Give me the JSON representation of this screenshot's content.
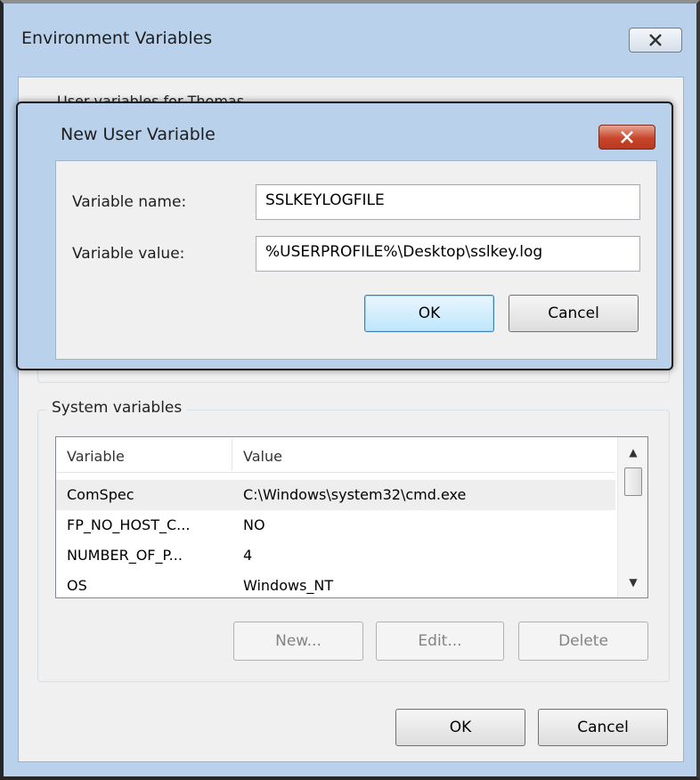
{
  "env_window": {
    "title": "Environment Variables",
    "user_group_legend": "User variables for Thomas",
    "system_group": {
      "legend": "System variables",
      "columns": [
        "Variable",
        "Value"
      ],
      "rows": [
        {
          "variable": "ComSpec",
          "value": "C:\\Windows\\system32\\cmd.exe"
        },
        {
          "variable": "FP_NO_HOST_C...",
          "value": "NO"
        },
        {
          "variable": "NUMBER_OF_P...",
          "value": "4"
        },
        {
          "variable": "OS",
          "value": "Windows_NT"
        }
      ],
      "buttons": {
        "new": "New...",
        "edit": "Edit...",
        "delete": "Delete"
      }
    },
    "buttons": {
      "ok": "OK",
      "cancel": "Cancel"
    }
  },
  "dialog": {
    "title": "New User Variable",
    "name_label": "Variable name:",
    "name_value": "SSLKEYLOGFILE",
    "value_label": "Variable value:",
    "value_value": "%USERPROFILE%\\Desktop\\sslkey.log",
    "ok": "OK",
    "cancel": "Cancel"
  },
  "icons": {
    "env_close": "close-icon",
    "dialog_close": "close-icon"
  }
}
